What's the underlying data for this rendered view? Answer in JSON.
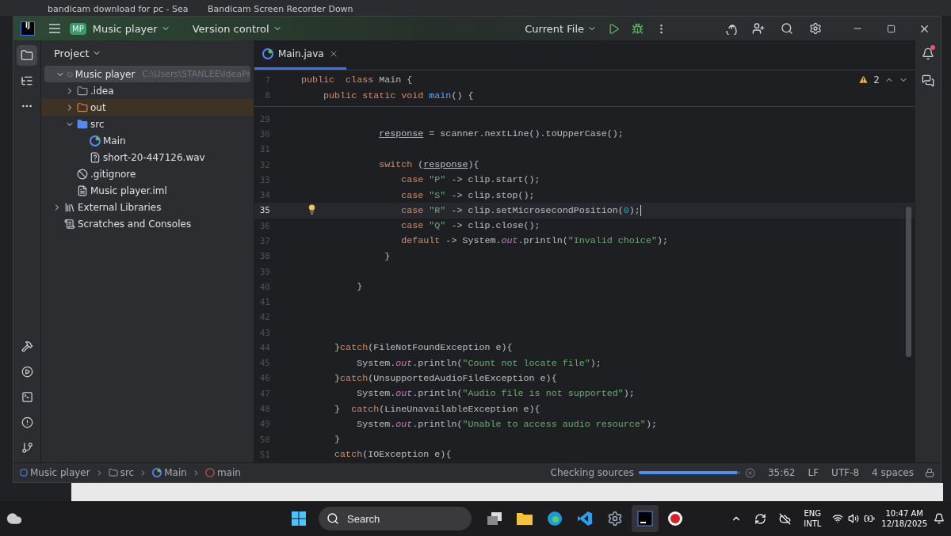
{
  "browser_tabs": [
    {
      "title": "bandicam download for pc - Sea"
    },
    {
      "title": "Bandicam Screen Recorder Down"
    }
  ],
  "header": {
    "logo": "IJ",
    "project_badge": "MP",
    "project": "Music player",
    "vcs": "Version control",
    "run_config": "Current File"
  },
  "project_panel": {
    "title": "Project",
    "tree": [
      {
        "label": "Music player",
        "path": "C:\\Users\\STANLEE\\IdeaPr",
        "kind": "project",
        "selected": true,
        "expanded": true,
        "children": [
          {
            "label": ".idea",
            "kind": "folder",
            "selected": false,
            "expanded": false
          },
          {
            "label": "out",
            "kind": "excluded-folder",
            "selected": false,
            "expanded": false
          },
          {
            "label": "src",
            "kind": "source-folder",
            "selected": false,
            "expanded": true,
            "children": [
              {
                "label": "Main",
                "kind": "class",
                "selected": false
              },
              {
                "label": "short-20-447126.wav",
                "kind": "unknown-file",
                "selected": false
              }
            ]
          },
          {
            "label": ".gitignore",
            "kind": "ignore-file",
            "selected": false
          },
          {
            "label": "Music player.iml",
            "kind": "module-file",
            "selected": false
          }
        ]
      },
      {
        "label": "External Libraries",
        "kind": "libraries",
        "selected": false,
        "expanded": false
      },
      {
        "label": "Scratches and Consoles",
        "kind": "scratches",
        "selected": false
      }
    ]
  },
  "editor": {
    "tabs": [
      {
        "label": "Main.java",
        "selected": true
      }
    ],
    "warnings": "2",
    "sticky_lines": [
      {
        "number": "7",
        "tokens": [
          {
            "kind": "keyword",
            "t": "public  class "
          },
          {
            "kind": "plain",
            "t": "Main {"
          }
        ]
      },
      {
        "number": "8",
        "tokens": [
          {
            "kind": "keyword",
            "t": "    public static void "
          },
          {
            "kind": "method",
            "t": "main"
          },
          {
            "kind": "plain",
            "t": "() {"
          }
        ]
      }
    ],
    "lines": [
      {
        "number": "29",
        "current": false
      },
      {
        "number": "30",
        "current": false,
        "tokens": [
          {
            "kind": "var",
            "t": "              response"
          },
          {
            "kind": "plain",
            "t": " = scanner.nextLine().toUpperCase();"
          }
        ]
      },
      {
        "number": "31",
        "current": false
      },
      {
        "number": "32",
        "current": false,
        "tokens": [
          {
            "kind": "keyword",
            "t": "              switch"
          },
          {
            "kind": "plain",
            "t": " ("
          },
          {
            "kind": "var",
            "t": "response"
          },
          {
            "kind": "plain",
            "t": "){"
          }
        ]
      },
      {
        "number": "33",
        "current": false,
        "tokens": [
          {
            "kind": "keyword",
            "t": "                  case "
          },
          {
            "kind": "string",
            "t": "\"P\""
          },
          {
            "kind": "plain",
            "t": " -> clip.start();"
          }
        ]
      },
      {
        "number": "34",
        "current": false,
        "tokens": [
          {
            "kind": "keyword",
            "t": "                  case "
          },
          {
            "kind": "string",
            "t": "\"S\""
          },
          {
            "kind": "plain",
            "t": " -> clip.stop();"
          }
        ]
      },
      {
        "number": "35",
        "current": true,
        "tokens": [
          {
            "kind": "keyword",
            "t": "                  case "
          },
          {
            "kind": "string",
            "t": "\"R\""
          },
          {
            "kind": "plain",
            "t": " -> clip.setMicrosecondPosition("
          },
          {
            "kind": "number",
            "t": "0"
          },
          {
            "kind": "plain",
            "t": ");"
          }
        ]
      },
      {
        "number": "36",
        "current": false,
        "tokens": [
          {
            "kind": "keyword",
            "t": "                  case "
          },
          {
            "kind": "string",
            "t": "\"Q\""
          },
          {
            "kind": "plain",
            "t": " -> clip.close();"
          }
        ]
      },
      {
        "number": "37",
        "current": false,
        "tokens": [
          {
            "kind": "keyword",
            "t": "                  default"
          },
          {
            "kind": "plain",
            "t": " -> System."
          },
          {
            "kind": "field",
            "t": "out"
          },
          {
            "kind": "plain",
            "t": ".println("
          },
          {
            "kind": "string",
            "t": "\"Invalid choice\""
          },
          {
            "kind": "plain",
            "t": ");"
          }
        ]
      },
      {
        "number": "38",
        "current": false,
        "tokens": [
          {
            "kind": "plain",
            "t": "               }"
          }
        ]
      },
      {
        "number": "39",
        "current": false
      },
      {
        "number": "40",
        "current": false,
        "tokens": [
          {
            "kind": "plain",
            "t": "          }"
          }
        ]
      },
      {
        "number": "41",
        "current": false
      },
      {
        "number": "42",
        "current": false
      },
      {
        "number": "43",
        "current": false
      },
      {
        "number": "44",
        "current": false,
        "tokens": [
          {
            "kind": "plain",
            "t": "      }"
          },
          {
            "kind": "keyword",
            "t": "catch"
          },
          {
            "kind": "plain",
            "t": "(FileNotFoundException e){"
          }
        ]
      },
      {
        "number": "45",
        "current": false,
        "tokens": [
          {
            "kind": "plain",
            "t": "          System."
          },
          {
            "kind": "field",
            "t": "out"
          },
          {
            "kind": "plain",
            "t": ".println("
          },
          {
            "kind": "string",
            "t": "\"Count not locate file\""
          },
          {
            "kind": "plain",
            "t": ");"
          }
        ]
      },
      {
        "number": "46",
        "current": false,
        "tokens": [
          {
            "kind": "plain",
            "t": "      }"
          },
          {
            "kind": "keyword",
            "t": "catch"
          },
          {
            "kind": "plain",
            "t": "(UnsupportedAudioFileException e){"
          }
        ]
      },
      {
        "number": "47",
        "current": false,
        "tokens": [
          {
            "kind": "plain",
            "t": "          System."
          },
          {
            "kind": "field",
            "t": "out"
          },
          {
            "kind": "plain",
            "t": ".println("
          },
          {
            "kind": "string",
            "t": "\"Audio file is not supported\""
          },
          {
            "kind": "plain",
            "t": ");"
          }
        ]
      },
      {
        "number": "48",
        "current": false,
        "tokens": [
          {
            "kind": "plain",
            "t": "      }  "
          },
          {
            "kind": "keyword",
            "t": "catch"
          },
          {
            "kind": "plain",
            "t": "(LineUnavailableException e){"
          }
        ]
      },
      {
        "number": "49",
        "current": false,
        "tokens": [
          {
            "kind": "plain",
            "t": "          System."
          },
          {
            "kind": "field",
            "t": "out"
          },
          {
            "kind": "plain",
            "t": ".println("
          },
          {
            "kind": "string",
            "t": "\"Unable to access audio resource\""
          },
          {
            "kind": "plain",
            "t": ");"
          }
        ]
      },
      {
        "number": "50",
        "current": false,
        "tokens": [
          {
            "kind": "plain",
            "t": "      }"
          }
        ]
      },
      {
        "number": "51",
        "current": false,
        "tokens": [
          {
            "kind": "keyword",
            "t": "      catch"
          },
          {
            "kind": "plain",
            "t": "(IOException e){"
          }
        ]
      }
    ]
  },
  "status_bar": {
    "breadcrumbs": [
      {
        "label": "Music player",
        "kind": "module"
      },
      {
        "label": "src",
        "kind": "folder"
      },
      {
        "label": "Main",
        "kind": "class"
      },
      {
        "label": "main",
        "kind": "method"
      }
    ],
    "task": "Checking sources",
    "progress": {
      "level": 0.97
    },
    "position": "35:62",
    "line_ending": "LF",
    "encoding": "UTF-8",
    "indent": "4 spaces"
  },
  "taskbar": {
    "search": {
      "placeholder": "Search"
    },
    "language": "ENG",
    "layout": "INTL",
    "time": "10:47 AM",
    "date": "12/18/2025"
  }
}
